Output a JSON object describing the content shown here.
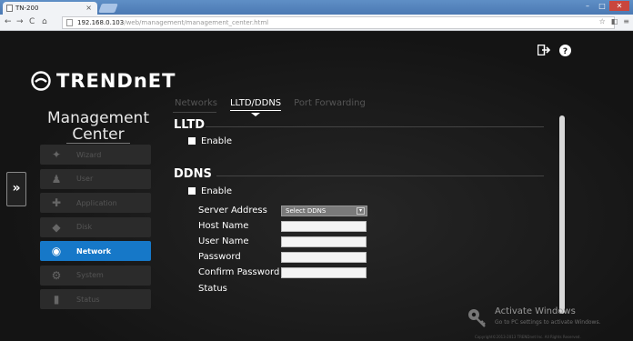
{
  "browser": {
    "tab_title": "TN-200",
    "tab_close": "×",
    "url_host": "192.168.0.103",
    "url_path": "/web/management/management_center.html"
  },
  "header": {
    "logo_text": "TRENDnET",
    "sidebar_title_line1": "Management",
    "sidebar_title_line2": "Center"
  },
  "sidebar": {
    "toggle": "»",
    "items": [
      {
        "label": "Wizard",
        "icon": "wizard-icon",
        "glyph": "✦"
      },
      {
        "label": "User",
        "icon": "user-icon",
        "glyph": "♟"
      },
      {
        "label": "Application",
        "icon": "application-icon",
        "glyph": "✚"
      },
      {
        "label": "Disk",
        "icon": "disk-icon",
        "glyph": "◆"
      },
      {
        "label": "Network",
        "icon": "network-icon",
        "glyph": "◉",
        "active": true
      },
      {
        "label": "System",
        "icon": "system-icon",
        "glyph": "⚙"
      },
      {
        "label": "Status",
        "icon": "status-icon",
        "glyph": "▮"
      }
    ]
  },
  "tabs": [
    {
      "label": "Networks"
    },
    {
      "label": "LLTD/DDNS",
      "active": true
    },
    {
      "label": "Port Forwarding"
    }
  ],
  "lltd": {
    "title": "LLTD",
    "enable_label": "Enable"
  },
  "ddns": {
    "title": "DDNS",
    "enable_label": "Enable",
    "server_address_label": "Server Address",
    "server_address_value": "Select DDNS",
    "host_name_label": "Host Name",
    "user_name_label": "User Name",
    "password_label": "Password",
    "confirm_password_label": "Confirm Password",
    "status_label": "Status"
  },
  "watermark": {
    "line1": "Activate Windows",
    "line2": "Go to PC settings to activate Windows."
  },
  "footer": {
    "copyright": "Copyright©2013-2013 TRENDnet Inc. All Rights Reserved."
  },
  "colors": {
    "accent": "#1678c8",
    "background": "#161616",
    "text": "#ffffff",
    "muted_text": "#555555"
  }
}
